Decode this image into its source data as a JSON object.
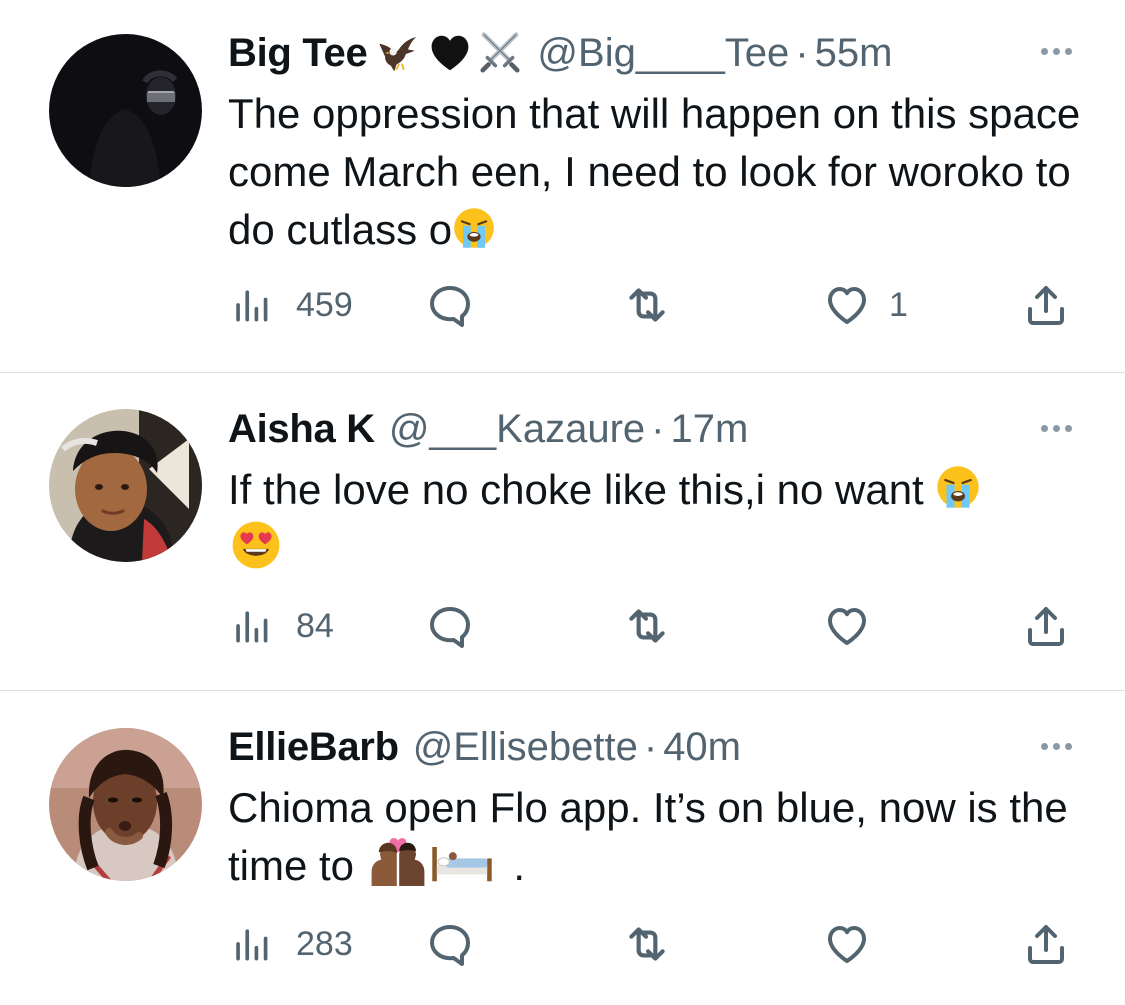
{
  "tweets": [
    {
      "name": "Big Tee",
      "badges": [
        "eagle-emoji",
        "black-heart-emoji",
        "crossed-swords-emoji"
      ],
      "handle": "@Big____Tee",
      "separator": "·",
      "time": "55m",
      "text": "The oppression that will happen on this space come March een, I need to look for woroko to do cutlass o",
      "trailing_emoji": [
        "loudly-crying-face-emoji"
      ],
      "stats": {
        "views": "459",
        "replies": "",
        "retweets": "",
        "likes": "1"
      }
    },
    {
      "name": "Aisha K",
      "handle": "@___Kazaure",
      "separator": "·",
      "time": "17m",
      "text": "If the love no choke like this,i no want ",
      "trailing_emoji": [
        "loudly-crying-face-emoji",
        "smiling-face-with-heart-eyes-emoji"
      ],
      "stats": {
        "views": "84",
        "replies": "",
        "retweets": "",
        "likes": ""
      }
    },
    {
      "name": "EllieBarb",
      "handle": "@Ellisebette",
      "separator": "·",
      "time": "40m",
      "text": "Chioma open Flo app. It’s on blue, now is the time to",
      "trailing_emoji": [
        "kiss-emoji",
        "bed-emoji"
      ],
      "text_end": ".",
      "stats": {
        "views": "283",
        "replies": "",
        "retweets": "",
        "likes": ""
      }
    }
  ],
  "icons": {
    "views": "bar-chart-icon",
    "reply": "speech-bubble-icon",
    "retweet": "retweet-icon",
    "like": "heart-icon",
    "share": "share-upload-icon",
    "more": "more-dots-icon"
  },
  "colors": {
    "text": "#0f1419",
    "secondary": "#536471",
    "divider": "#d9dee2",
    "background": "#ffffff"
  }
}
